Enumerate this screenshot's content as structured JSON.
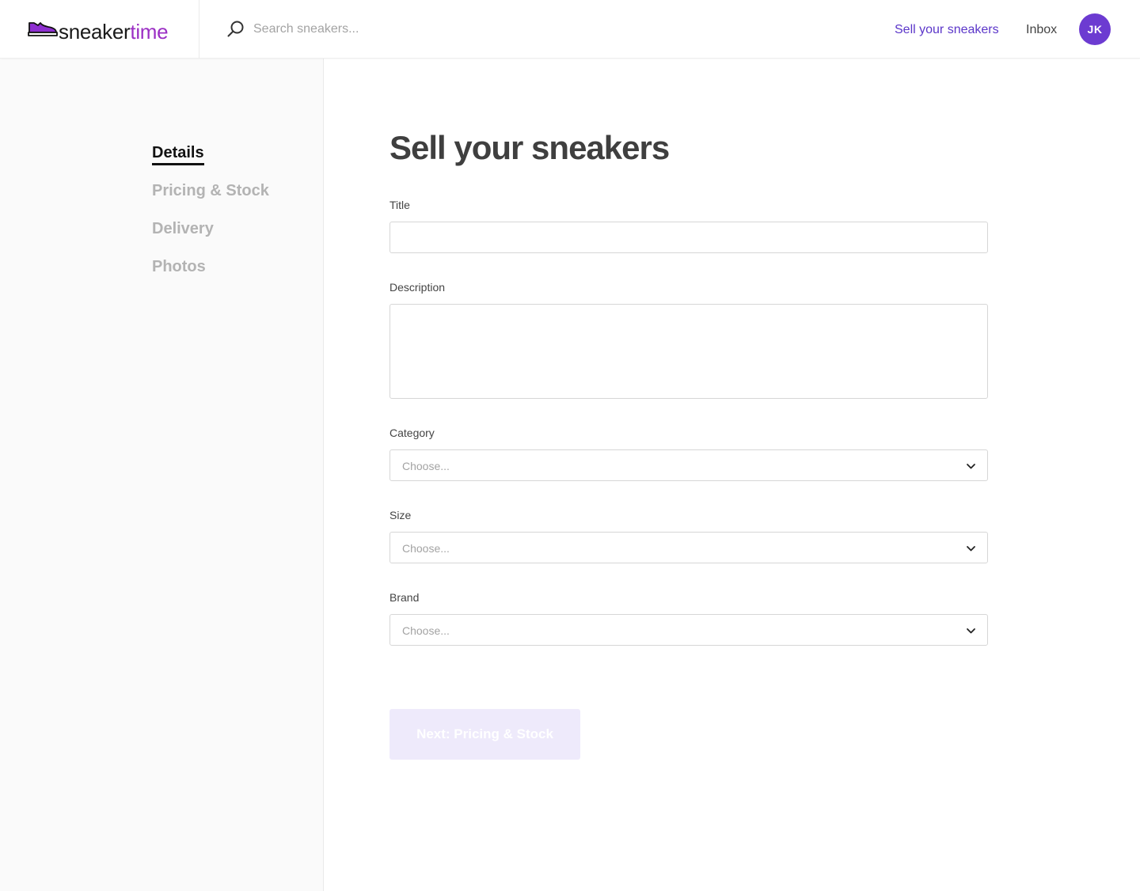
{
  "header": {
    "logo": {
      "part1": "sneaker",
      "part2": "time",
      "icon": "sneaker-icon"
    },
    "search": {
      "placeholder": "Search sneakers...",
      "value": "",
      "icon": "search-icon"
    },
    "nav": {
      "sell_label": "Sell your sneakers",
      "inbox_label": "Inbox"
    },
    "avatar_initials": "JK"
  },
  "sidebar": {
    "steps": [
      {
        "label": "Details",
        "active": true
      },
      {
        "label": "Pricing & Stock",
        "active": false
      },
      {
        "label": "Delivery",
        "active": false
      },
      {
        "label": "Photos",
        "active": false
      }
    ]
  },
  "form": {
    "title": "Sell your sneakers",
    "fields": {
      "title": {
        "label": "Title",
        "value": ""
      },
      "description": {
        "label": "Description",
        "value": ""
      },
      "category": {
        "label": "Category",
        "value": "Choose..."
      },
      "size": {
        "label": "Size",
        "value": "Choose..."
      },
      "brand": {
        "label": "Brand",
        "value": "Choose..."
      }
    },
    "next_label": "Next: Pricing & Stock"
  },
  "colors": {
    "brand_purple": "#6c3bd1",
    "logo_accent": "#9b2fc4",
    "link_purple": "#5b36c9",
    "disabled_button": "#eeeafb"
  }
}
